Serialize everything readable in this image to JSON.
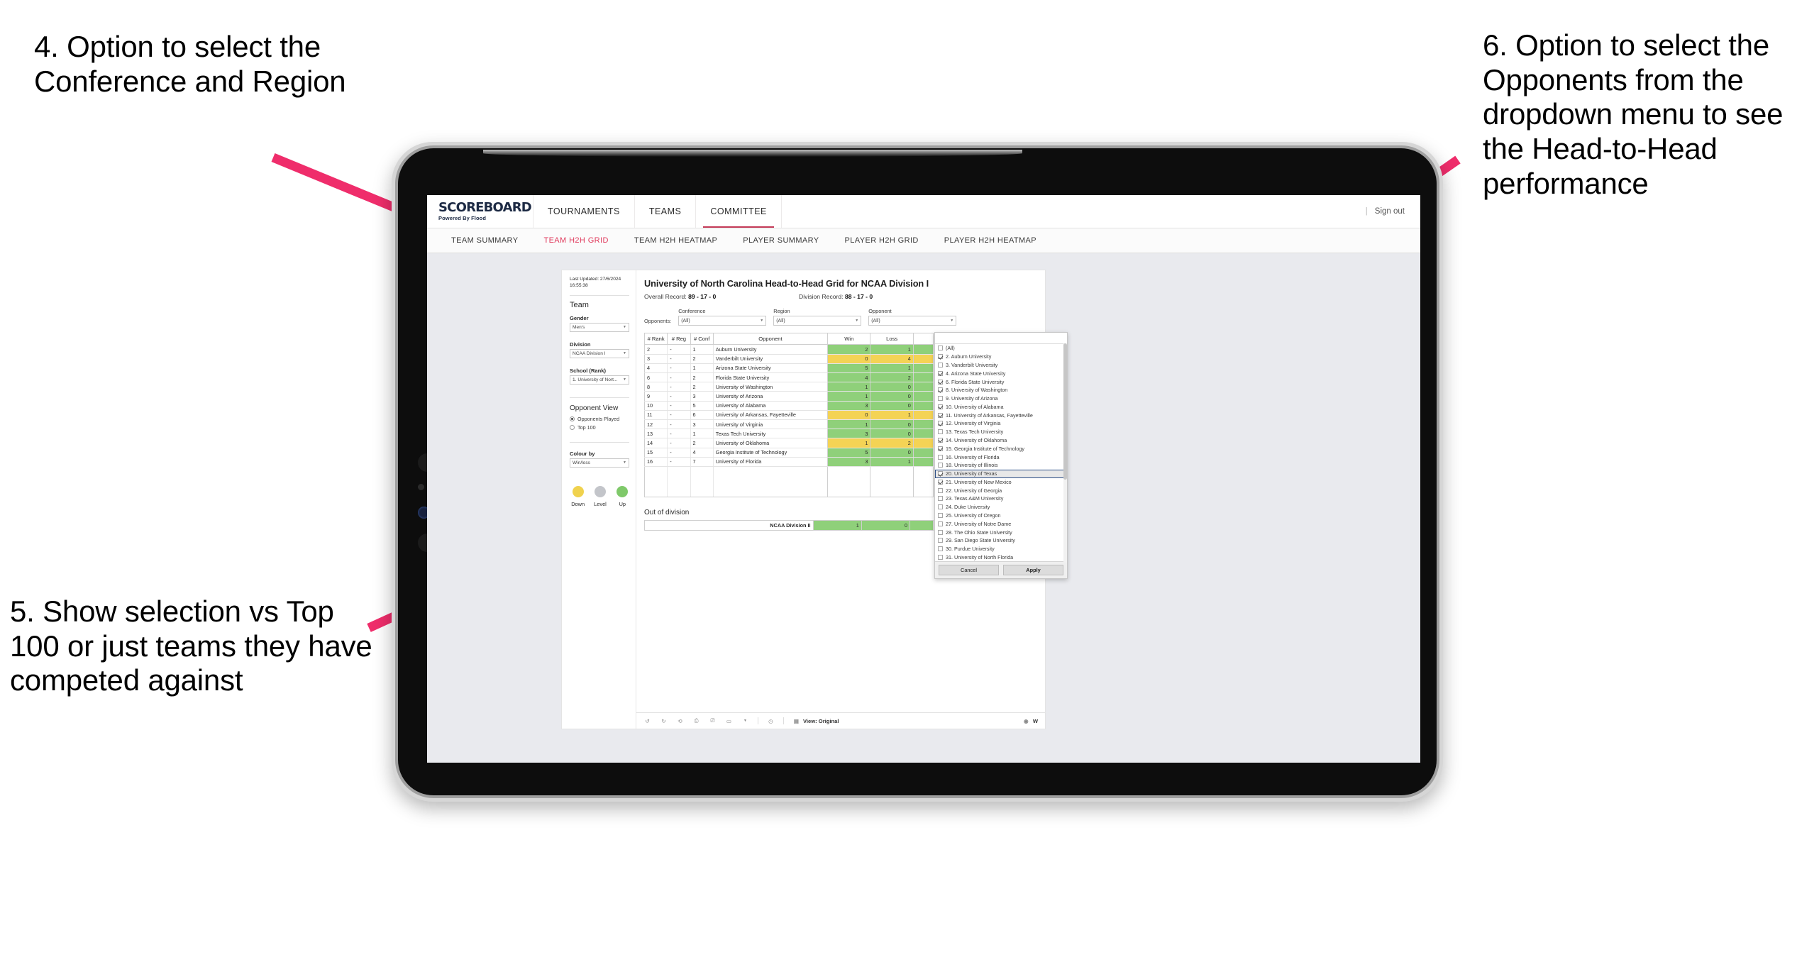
{
  "annotations": {
    "note4": "4. Option to select the Conference and Region",
    "note5": "5. Show selection vs Top 100 or just teams they have competed against",
    "note6": "6. Option to select the Opponents from the dropdown menu to see the Head-to-Head performance",
    "arrow_color": "#ef2d6b"
  },
  "app": {
    "brand": {
      "title": "SCOREBOARD",
      "subtitle": "Powered By Flood"
    },
    "top_nav": [
      {
        "label": "TOURNAMENTS",
        "active": false
      },
      {
        "label": "TEAMS",
        "active": false
      },
      {
        "label": "COMMITTEE",
        "active": true
      }
    ],
    "top_right": {
      "separator": "|",
      "sign_out": "Sign out"
    },
    "sub_nav": [
      {
        "label": "TEAM SUMMARY",
        "active": false
      },
      {
        "label": "TEAM H2H GRID",
        "active": true
      },
      {
        "label": "TEAM H2H HEATMAP",
        "active": false
      },
      {
        "label": "PLAYER SUMMARY",
        "active": false
      },
      {
        "label": "PLAYER H2H GRID",
        "active": false
      },
      {
        "label": "PLAYER H2H HEATMAP",
        "active": false
      }
    ]
  },
  "rail": {
    "last_updated": "Last Updated: 27/6/2024 16:55:38",
    "team_heading": "Team",
    "gender_label": "Gender",
    "gender_value": "Men's",
    "division_label": "Division",
    "division_value": "NCAA Division I",
    "school_label": "School (Rank)",
    "school_value": "1. University of Nort...",
    "opponent_view_heading": "Opponent View",
    "opponent_view_options": [
      {
        "label": "Opponents Played",
        "selected": true
      },
      {
        "label": "Top 100",
        "selected": false
      }
    ],
    "colour_by_label": "Colour by",
    "colour_by_value": "Win/loss",
    "legend": [
      {
        "label": "Down",
        "color": "#f0d24e"
      },
      {
        "label": "Level",
        "color": "#c3c5ca"
      },
      {
        "label": "Up",
        "color": "#7fc96a"
      }
    ]
  },
  "viz": {
    "title": "University of North Carolina Head-to-Head Grid for NCAA Division I",
    "overall_record_label": "Overall Record:",
    "overall_record_value": "89 - 17 - 0",
    "division_record_label": "Division Record:",
    "division_record_value": "88 - 17 - 0",
    "opponents_tag": "Opponents:",
    "filters": [
      {
        "label": "Conference",
        "value": "(All)"
      },
      {
        "label": "Region",
        "value": "(All)"
      },
      {
        "label": "Opponent",
        "value": "(All)"
      }
    ],
    "out_of_division_heading": "Out of division",
    "out_of_division_row": {
      "label": "NCAA Division II",
      "win": "1",
      "loss": "0",
      "color": "g"
    }
  },
  "chart_data": {
    "type": "table",
    "title": "University of North Carolina Head-to-Head Grid for NCAA Division I",
    "columns": [
      "# Rank",
      "# Reg",
      "# Conf",
      "Opponent",
      "Win",
      "Loss"
    ],
    "rows": [
      {
        "rank": "2",
        "reg": "-",
        "conf": "1",
        "opponent": "Auburn University",
        "win": "2",
        "loss": "1",
        "color": "g"
      },
      {
        "rank": "3",
        "reg": "-",
        "conf": "2",
        "opponent": "Vanderbilt University",
        "win": "0",
        "loss": "4",
        "color": "y"
      },
      {
        "rank": "4",
        "reg": "-",
        "conf": "1",
        "opponent": "Arizona State University",
        "win": "5",
        "loss": "1",
        "color": "g"
      },
      {
        "rank": "6",
        "reg": "-",
        "conf": "2",
        "opponent": "Florida State University",
        "win": "4",
        "loss": "2",
        "color": "g"
      },
      {
        "rank": "8",
        "reg": "-",
        "conf": "2",
        "opponent": "University of Washington",
        "win": "1",
        "loss": "0",
        "color": "g"
      },
      {
        "rank": "9",
        "reg": "-",
        "conf": "3",
        "opponent": "University of Arizona",
        "win": "1",
        "loss": "0",
        "color": "g"
      },
      {
        "rank": "10",
        "reg": "-",
        "conf": "5",
        "opponent": "University of Alabama",
        "win": "3",
        "loss": "0",
        "color": "g"
      },
      {
        "rank": "11",
        "reg": "-",
        "conf": "6",
        "opponent": "University of Arkansas, Fayetteville",
        "win": "0",
        "loss": "1",
        "color": "y"
      },
      {
        "rank": "12",
        "reg": "-",
        "conf": "3",
        "opponent": "University of Virginia",
        "win": "1",
        "loss": "0",
        "color": "g"
      },
      {
        "rank": "13",
        "reg": "-",
        "conf": "1",
        "opponent": "Texas Tech University",
        "win": "3",
        "loss": "0",
        "color": "g"
      },
      {
        "rank": "14",
        "reg": "-",
        "conf": "2",
        "opponent": "University of Oklahoma",
        "win": "1",
        "loss": "2",
        "color": "y"
      },
      {
        "rank": "15",
        "reg": "-",
        "conf": "4",
        "opponent": "Georgia Institute of Technology",
        "win": "5",
        "loss": "0",
        "color": "g"
      },
      {
        "rank": "16",
        "reg": "-",
        "conf": "7",
        "opponent": "University of Florida",
        "win": "3",
        "loss": "1",
        "color": "g"
      }
    ],
    "colors": {
      "up": "#8fd07a",
      "down": "#f4d355",
      "level": "#c3c5ca"
    }
  },
  "opponent_dropdown": {
    "items": [
      {
        "label": "(All)",
        "checked": false,
        "selected": false
      },
      {
        "label": "2. Auburn University",
        "checked": true,
        "selected": false
      },
      {
        "label": "3. Vanderbilt University",
        "checked": false,
        "selected": false
      },
      {
        "label": "4. Arizona State University",
        "checked": true,
        "selected": false
      },
      {
        "label": "6. Florida State University",
        "checked": true,
        "selected": false
      },
      {
        "label": "8. University of Washington",
        "checked": true,
        "selected": false
      },
      {
        "label": "9. University of Arizona",
        "checked": false,
        "selected": false
      },
      {
        "label": "10. University of Alabama",
        "checked": true,
        "selected": false
      },
      {
        "label": "11. University of Arkansas, Fayetteville",
        "checked": true,
        "selected": false
      },
      {
        "label": "12. University of Virginia",
        "checked": true,
        "selected": false
      },
      {
        "label": "13. Texas Tech University",
        "checked": false,
        "selected": false
      },
      {
        "label": "14. University of Oklahoma",
        "checked": true,
        "selected": false
      },
      {
        "label": "15. Georgia Institute of Technology",
        "checked": true,
        "selected": false
      },
      {
        "label": "16. University of Florida",
        "checked": false,
        "selected": false
      },
      {
        "label": "18. University of Illinois",
        "checked": false,
        "selected": false
      },
      {
        "label": "20. University of Texas",
        "checked": true,
        "selected": true
      },
      {
        "label": "21. University of New Mexico",
        "checked": true,
        "selected": false
      },
      {
        "label": "22. University of Georgia",
        "checked": false,
        "selected": false
      },
      {
        "label": "23. Texas A&M University",
        "checked": false,
        "selected": false
      },
      {
        "label": "24. Duke University",
        "checked": false,
        "selected": false
      },
      {
        "label": "25. University of Oregon",
        "checked": false,
        "selected": false
      },
      {
        "label": "27. University of Notre Dame",
        "checked": false,
        "selected": false
      },
      {
        "label": "28. The Ohio State University",
        "checked": false,
        "selected": false
      },
      {
        "label": "29. San Diego State University",
        "checked": false,
        "selected": false
      },
      {
        "label": "30. Purdue University",
        "checked": false,
        "selected": false
      },
      {
        "label": "31. University of North Florida",
        "checked": false,
        "selected": false
      }
    ],
    "cancel_label": "Cancel",
    "apply_label": "Apply"
  },
  "toolbar": {
    "view_label": "View: Original",
    "right_label": "W"
  }
}
